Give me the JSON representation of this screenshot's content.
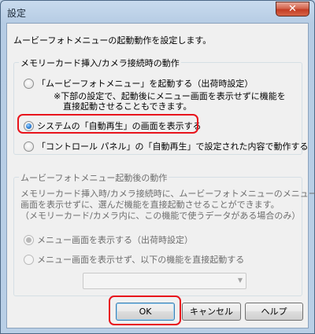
{
  "window": {
    "title": "設定",
    "close_glyph": "✕"
  },
  "intro_text": "ムービーフォトメニューの起動動作を設定します。",
  "group1": {
    "title": "メモリーカード挿入/カメラ接続時の動作",
    "option1": {
      "label": "「ムービーフォトメニュー」を起動する（出荷時設定）",
      "note_lines": [
        "※下部の設定で、起動後にメニュー画面を表示せずに機能を",
        "直接起動させることもできます。"
      ]
    },
    "option2": {
      "label": "システムの「自動再生」の画面を表示する"
    },
    "option3": {
      "label": "「コントロール パネル」の「自動再生」で設定された内容で動作する"
    }
  },
  "group2": {
    "title": "ムービーフォトメニュー起動後の動作",
    "description_lines": [
      "メモリーカード挿入時/カメラ接続時に、ムービーフォトメニューのメニュー",
      "画面を表示せずに、選んだ機能を直接起動させることができます。",
      "（メモリーカード/カメラ内に、この機能で使うデータがある場合のみ）"
    ],
    "option1": {
      "label": "メニュー画面を表示する（出荷時設定）"
    },
    "option2": {
      "label": "メニュー画面を表示せず、以下の機能を直接起動する"
    },
    "combo_value": ""
  },
  "buttons": {
    "ok": "OK",
    "cancel": "キャンセル",
    "help": "ヘルプ"
  },
  "colors": {
    "highlight": "#e8141c",
    "titlebar": "#c9dbee",
    "dialog_bg": "#f0f0f0"
  }
}
